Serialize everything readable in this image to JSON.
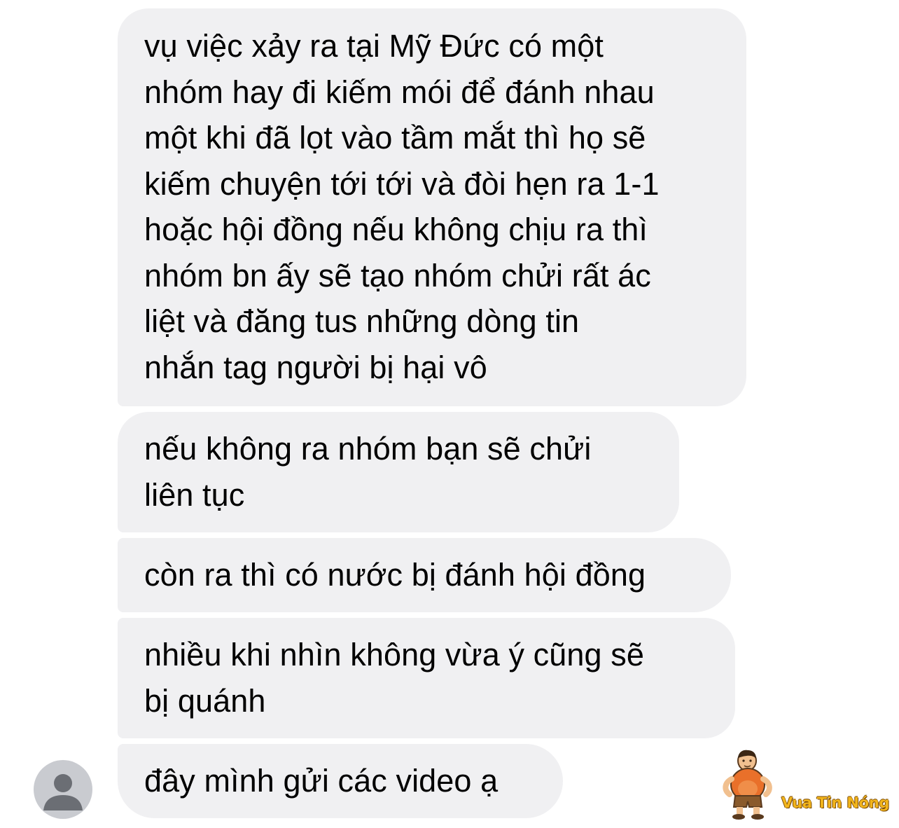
{
  "messages": [
    {
      "text": "vụ việc xảy ra tại Mỹ Đức có một\nnhóm hay đi kiếm mói để đánh nhau\nmột khi đã lọt vào tầm mắt thì họ sẽ\nkiếm chuyện tới tới và đòi hẹn ra 1-1\nhoặc hội đồng nếu không chịu ra thì\nnhóm bn ấy sẽ tạo nhóm chửi rất ác\nliệt và đăng tus những dòng tin\nnhắn tag người bị hại vô"
    },
    {
      "text": "nếu không ra nhóm bạn sẽ chửi\nliên tục"
    },
    {
      "text": "còn ra thì có nước bị đánh hội đồng"
    },
    {
      "text": "nhiều khi nhìn không vừa ý cũng sẽ\nbị quánh"
    },
    {
      "text": "đây mình gửi các video ạ"
    }
  ],
  "watermark": {
    "text": "Vua Tin Nóng"
  },
  "colors": {
    "bubble_bg": "#f0f0f2",
    "text": "#000000",
    "avatar_bg": "#c9cbd0",
    "avatar_fg": "#6b6e74",
    "watermark_text": "#f2b51c"
  },
  "icons": {
    "avatar": "person-silhouette-icon",
    "watermark_logo": "cartoon-man-mascot-icon"
  }
}
